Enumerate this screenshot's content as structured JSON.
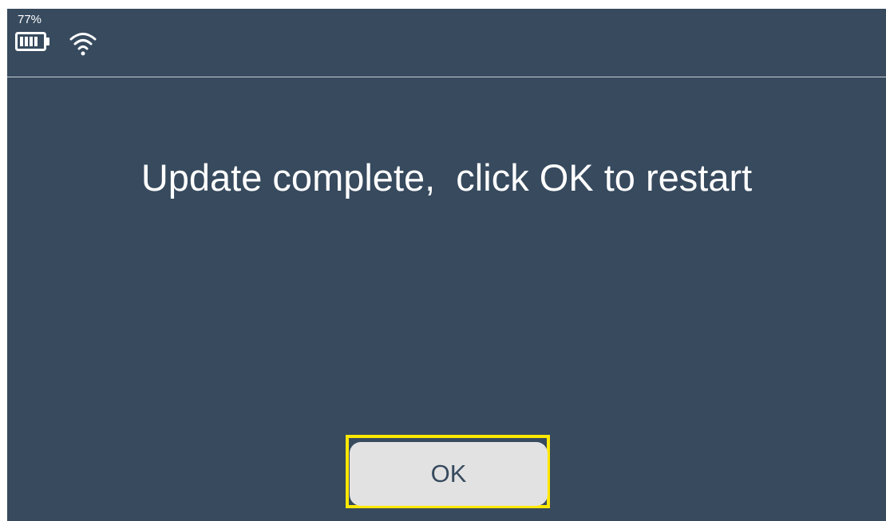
{
  "status_bar": {
    "battery_percent": "77%",
    "battery_icon": "battery-icon",
    "wifi_icon": "wifi-icon"
  },
  "dialog": {
    "message": "Update complete,  click OK to restart",
    "ok_label": "OK"
  },
  "colors": {
    "background": "#374a5e",
    "text": "#ffffff",
    "button_bg": "#e2e2e2",
    "highlight": "#ffe800"
  }
}
